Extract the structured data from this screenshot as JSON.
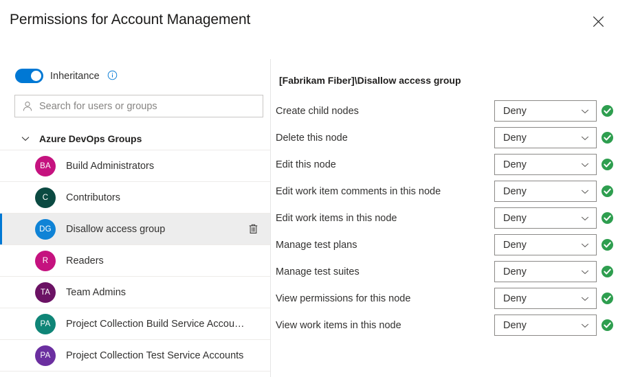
{
  "dialog": {
    "title": "Permissions for Account Management",
    "close_icon": "close-icon"
  },
  "left": {
    "inheritance": {
      "label": "Inheritance",
      "enabled": true,
      "info_icon": "info-icon",
      "toggle_on_color": "#0078d4"
    },
    "search": {
      "value": "",
      "placeholder": "Search for users or groups",
      "icon": "person-icon"
    },
    "group_section": {
      "header": "Azure DevOps Groups",
      "expanded": true,
      "chevron_icon": "chevron-down-icon"
    },
    "groups": [
      {
        "initials": "BA",
        "name": "Build Administrators",
        "color": "#c5127f",
        "selected": false,
        "deletable": false
      },
      {
        "initials": "C",
        "name": "Contributors",
        "color": "#0b4a42",
        "selected": false,
        "deletable": false
      },
      {
        "initials": "DG",
        "name": "Disallow access group",
        "color": "#0f83d6",
        "selected": true,
        "deletable": true,
        "delete_icon": "trash-icon"
      },
      {
        "initials": "R",
        "name": "Readers",
        "color": "#c5127f",
        "selected": false,
        "deletable": false
      },
      {
        "initials": "TA",
        "name": "Team Admins",
        "color": "#6b1264",
        "selected": false,
        "deletable": false
      },
      {
        "initials": "PA",
        "name": "Project Collection Build Service Accounts",
        "color": "#0f8577",
        "selected": false,
        "deletable": false
      },
      {
        "initials": "PA",
        "name": "Project Collection Test Service Accounts",
        "color": "#6b2fa0",
        "selected": false,
        "deletable": false
      }
    ]
  },
  "right": {
    "identity": "[Fabrikam Fiber]\\Disallow access group",
    "permissions": [
      {
        "label": "Create child nodes",
        "value": "Deny",
        "status_icon": "check-circle-icon"
      },
      {
        "label": "Delete this node",
        "value": "Deny",
        "status_icon": "check-circle-icon"
      },
      {
        "label": "Edit this node",
        "value": "Deny",
        "status_icon": "check-circle-icon"
      },
      {
        "label": "Edit work item comments in this node",
        "value": "Deny",
        "status_icon": "check-circle-icon"
      },
      {
        "label": "Edit work items in this node",
        "value": "Deny",
        "status_icon": "check-circle-icon"
      },
      {
        "label": "Manage test plans",
        "value": "Deny",
        "status_icon": "check-circle-icon"
      },
      {
        "label": "Manage test suites",
        "value": "Deny",
        "status_icon": "check-circle-icon"
      },
      {
        "label": "View permissions for this node",
        "value": "Deny",
        "status_icon": "check-circle-icon"
      },
      {
        "label": "View work items in this node",
        "value": "Deny",
        "status_icon": "check-circle-icon"
      }
    ],
    "status_color": "#2e9e4f",
    "dropdown_caret_icon": "chevron-down-icon"
  }
}
